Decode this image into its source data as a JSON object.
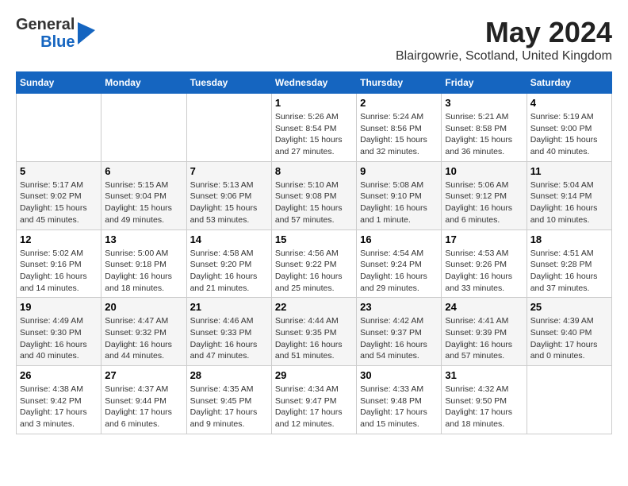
{
  "header": {
    "logo_line1": "General",
    "logo_line2": "Blue",
    "month_title": "May 2024",
    "location": "Blairgowrie, Scotland, United Kingdom"
  },
  "days_of_week": [
    "Sunday",
    "Monday",
    "Tuesday",
    "Wednesday",
    "Thursday",
    "Friday",
    "Saturday"
  ],
  "weeks": [
    [
      {
        "day": "",
        "info": ""
      },
      {
        "day": "",
        "info": ""
      },
      {
        "day": "",
        "info": ""
      },
      {
        "day": "1",
        "info": "Sunrise: 5:26 AM\nSunset: 8:54 PM\nDaylight: 15 hours and 27 minutes."
      },
      {
        "day": "2",
        "info": "Sunrise: 5:24 AM\nSunset: 8:56 PM\nDaylight: 15 hours and 32 minutes."
      },
      {
        "day": "3",
        "info": "Sunrise: 5:21 AM\nSunset: 8:58 PM\nDaylight: 15 hours and 36 minutes."
      },
      {
        "day": "4",
        "info": "Sunrise: 5:19 AM\nSunset: 9:00 PM\nDaylight: 15 hours and 40 minutes."
      }
    ],
    [
      {
        "day": "5",
        "info": "Sunrise: 5:17 AM\nSunset: 9:02 PM\nDaylight: 15 hours and 45 minutes."
      },
      {
        "day": "6",
        "info": "Sunrise: 5:15 AM\nSunset: 9:04 PM\nDaylight: 15 hours and 49 minutes."
      },
      {
        "day": "7",
        "info": "Sunrise: 5:13 AM\nSunset: 9:06 PM\nDaylight: 15 hours and 53 minutes."
      },
      {
        "day": "8",
        "info": "Sunrise: 5:10 AM\nSunset: 9:08 PM\nDaylight: 15 hours and 57 minutes."
      },
      {
        "day": "9",
        "info": "Sunrise: 5:08 AM\nSunset: 9:10 PM\nDaylight: 16 hours and 1 minute."
      },
      {
        "day": "10",
        "info": "Sunrise: 5:06 AM\nSunset: 9:12 PM\nDaylight: 16 hours and 6 minutes."
      },
      {
        "day": "11",
        "info": "Sunrise: 5:04 AM\nSunset: 9:14 PM\nDaylight: 16 hours and 10 minutes."
      }
    ],
    [
      {
        "day": "12",
        "info": "Sunrise: 5:02 AM\nSunset: 9:16 PM\nDaylight: 16 hours and 14 minutes."
      },
      {
        "day": "13",
        "info": "Sunrise: 5:00 AM\nSunset: 9:18 PM\nDaylight: 16 hours and 18 minutes."
      },
      {
        "day": "14",
        "info": "Sunrise: 4:58 AM\nSunset: 9:20 PM\nDaylight: 16 hours and 21 minutes."
      },
      {
        "day": "15",
        "info": "Sunrise: 4:56 AM\nSunset: 9:22 PM\nDaylight: 16 hours and 25 minutes."
      },
      {
        "day": "16",
        "info": "Sunrise: 4:54 AM\nSunset: 9:24 PM\nDaylight: 16 hours and 29 minutes."
      },
      {
        "day": "17",
        "info": "Sunrise: 4:53 AM\nSunset: 9:26 PM\nDaylight: 16 hours and 33 minutes."
      },
      {
        "day": "18",
        "info": "Sunrise: 4:51 AM\nSunset: 9:28 PM\nDaylight: 16 hours and 37 minutes."
      }
    ],
    [
      {
        "day": "19",
        "info": "Sunrise: 4:49 AM\nSunset: 9:30 PM\nDaylight: 16 hours and 40 minutes."
      },
      {
        "day": "20",
        "info": "Sunrise: 4:47 AM\nSunset: 9:32 PM\nDaylight: 16 hours and 44 minutes."
      },
      {
        "day": "21",
        "info": "Sunrise: 4:46 AM\nSunset: 9:33 PM\nDaylight: 16 hours and 47 minutes."
      },
      {
        "day": "22",
        "info": "Sunrise: 4:44 AM\nSunset: 9:35 PM\nDaylight: 16 hours and 51 minutes."
      },
      {
        "day": "23",
        "info": "Sunrise: 4:42 AM\nSunset: 9:37 PM\nDaylight: 16 hours and 54 minutes."
      },
      {
        "day": "24",
        "info": "Sunrise: 4:41 AM\nSunset: 9:39 PM\nDaylight: 16 hours and 57 minutes."
      },
      {
        "day": "25",
        "info": "Sunrise: 4:39 AM\nSunset: 9:40 PM\nDaylight: 17 hours and 0 minutes."
      }
    ],
    [
      {
        "day": "26",
        "info": "Sunrise: 4:38 AM\nSunset: 9:42 PM\nDaylight: 17 hours and 3 minutes."
      },
      {
        "day": "27",
        "info": "Sunrise: 4:37 AM\nSunset: 9:44 PM\nDaylight: 17 hours and 6 minutes."
      },
      {
        "day": "28",
        "info": "Sunrise: 4:35 AM\nSunset: 9:45 PM\nDaylight: 17 hours and 9 minutes."
      },
      {
        "day": "29",
        "info": "Sunrise: 4:34 AM\nSunset: 9:47 PM\nDaylight: 17 hours and 12 minutes."
      },
      {
        "day": "30",
        "info": "Sunrise: 4:33 AM\nSunset: 9:48 PM\nDaylight: 17 hours and 15 minutes."
      },
      {
        "day": "31",
        "info": "Sunrise: 4:32 AM\nSunset: 9:50 PM\nDaylight: 17 hours and 18 minutes."
      },
      {
        "day": "",
        "info": ""
      }
    ]
  ]
}
